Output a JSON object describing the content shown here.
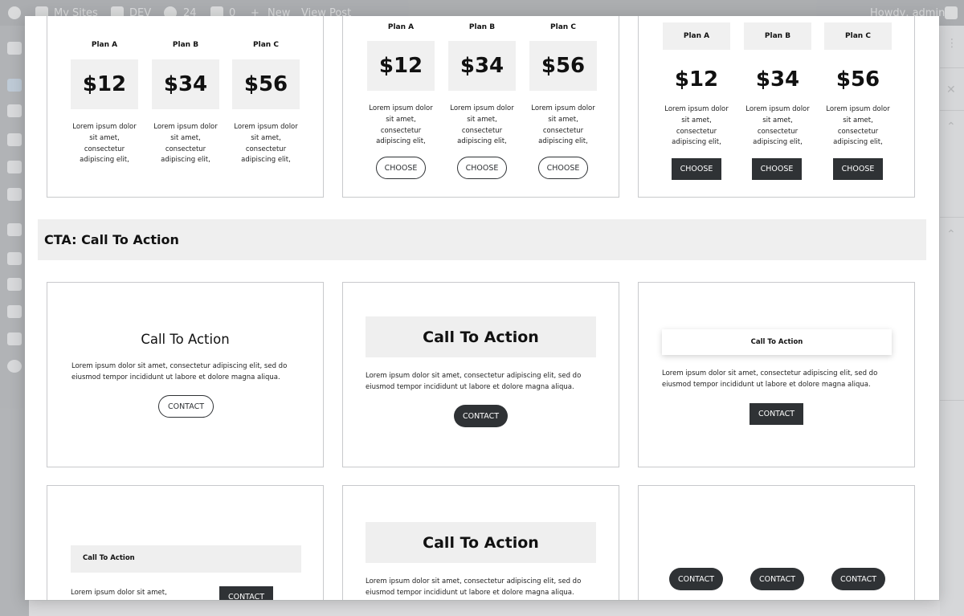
{
  "admin_bar": {
    "my_sites": "My Sites",
    "site_name": "DEV",
    "updates_count": "24",
    "comments_count": "0",
    "new_label": "New",
    "view_post": "View Post",
    "howdy": "Howdy, admin"
  },
  "pricing_cards": [
    {
      "style": "no-button",
      "plans": [
        {
          "name": "Plan A",
          "price": "$12",
          "desc": "Lorem ipsum dolor sit amet, consectetur adipiscing elit,"
        },
        {
          "name": "Plan B",
          "price": "$34",
          "desc": "Lorem ipsum dolor sit amet, consectetur adipiscing elit,"
        },
        {
          "name": "Plan C",
          "price": "$56",
          "desc": "Lorem ipsum dolor sit amet, consectetur adipiscing elit,"
        }
      ]
    },
    {
      "style": "outline-button",
      "plans": [
        {
          "name": "Plan A",
          "price": "$12",
          "desc": "Lorem ipsum dolor sit amet, consectetur adipiscing elit,",
          "button": "CHOOSE"
        },
        {
          "name": "Plan B",
          "price": "$34",
          "desc": "Lorem ipsum dolor sit amet, consectetur adipiscing elit,",
          "button": "CHOOSE"
        },
        {
          "name": "Plan C",
          "price": "$56",
          "desc": "Lorem ipsum dolor sit amet, consectetur adipiscing elit,",
          "button": "CHOOSE"
        }
      ]
    },
    {
      "style": "dark-button",
      "plans": [
        {
          "name": "Plan A",
          "price": "$12",
          "desc": "Lorem ipsum dolor sit amet, consectetur adipiscing elit,",
          "button": "CHOOSE"
        },
        {
          "name": "Plan B",
          "price": "$34",
          "desc": "Lorem ipsum dolor sit amet, consectetur adipiscing elit,",
          "button": "CHOOSE"
        },
        {
          "name": "Plan C",
          "price": "$56",
          "desc": "Lorem ipsum dolor sit amet, consectetur adipiscing elit,",
          "button": "CHOOSE"
        }
      ]
    }
  ],
  "section_title": "CTA: Call To Action",
  "cta_cards": {
    "card1": {
      "title": "Call To Action",
      "body_line1": "Lorem ipsum dolor sit amet, consectetur adipiscing elit, sed do",
      "body_line2": "eiusmod tempor incididunt ut labore et dolore magna aliqua.",
      "button": "CONTACT"
    },
    "card2": {
      "title": "Call To Action",
      "body_line1": "Lorem ipsum dolor sit amet, consectetur adipiscing elit, sed do",
      "body_line2": "eiusmod tempor incididunt ut labore et dolore magna aliqua.",
      "button": "CONTACT"
    },
    "card3": {
      "title": "Call To Action",
      "body_line1": "Lorem ipsum dolor sit amet, consectetur adipiscing elit, sed do",
      "body_line2": "eiusmod tempor incididunt ut labore et dolore magna aliqua.",
      "button": "CONTACT"
    },
    "card4": {
      "title": "Call To Action",
      "body": "Lorem ipsum dolor sit amet,",
      "button": "CONTACT"
    },
    "card5": {
      "title": "Call To Action",
      "body_line1": "Lorem ipsum dolor sit amet, consectetur adipiscing elit, sed do",
      "body_line2": "eiusmod tempor incididunt ut labore et dolore magna aliqua."
    },
    "card6": {
      "buttons": [
        "CONTACT",
        "CONTACT",
        "CONTACT"
      ]
    }
  }
}
